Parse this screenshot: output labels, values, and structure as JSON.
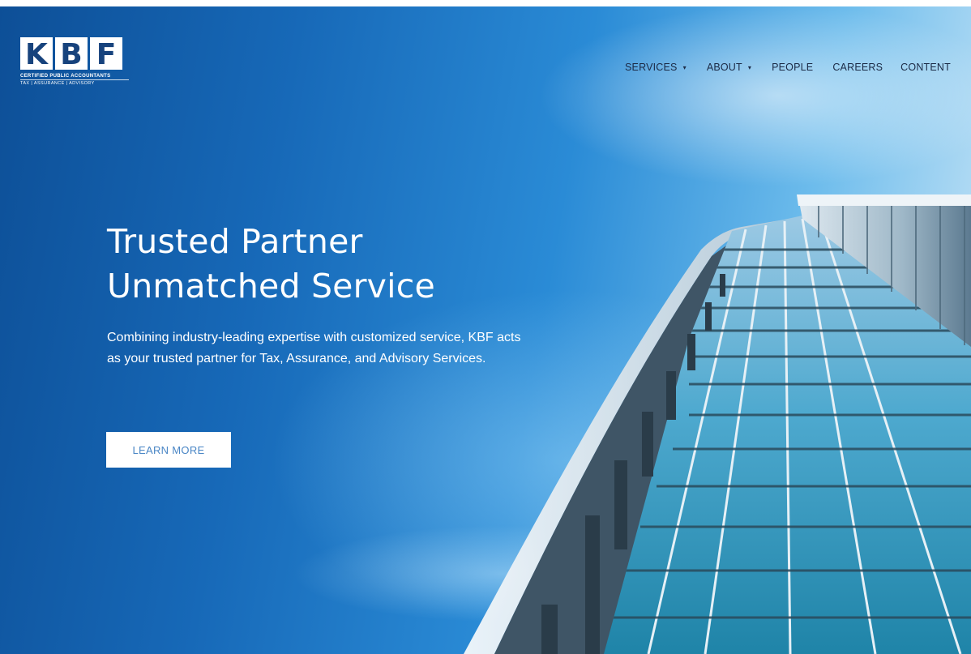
{
  "logo": {
    "letters": [
      "K",
      "B",
      "F"
    ],
    "line1": "CERTIFIED PUBLIC ACCOUNTANTS",
    "line2": "TAX | ASSURANCE | ADVISORY"
  },
  "nav": {
    "items": [
      {
        "label": "SERVICES",
        "has_dropdown": true
      },
      {
        "label": "ABOUT",
        "has_dropdown": true
      },
      {
        "label": "PEOPLE",
        "has_dropdown": false
      },
      {
        "label": "CAREERS",
        "has_dropdown": false
      },
      {
        "label": "CONTENT",
        "has_dropdown": false
      }
    ],
    "caret_glyph": "▾"
  },
  "hero": {
    "title_line1": "Trusted Partner",
    "title_line2": "Unmatched Service",
    "body": "Combining industry-leading expertise with customized service, KBF acts as your trusted partner for Tax, Assurance, and Advisory Services.",
    "cta_label": "LEARN MORE"
  },
  "colors": {
    "brand_navy": "#17437d",
    "nav_text": "#1b2a45",
    "cta_text": "#4a86c5",
    "sky_deep": "#0d4f97",
    "sky_light": "#cfe8f7"
  }
}
